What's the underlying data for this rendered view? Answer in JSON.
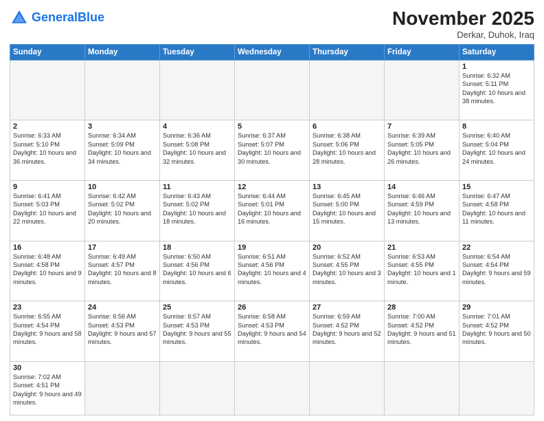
{
  "header": {
    "logo_general": "General",
    "logo_blue": "Blue",
    "month_title": "November 2025",
    "location": "Derkar, Duhok, Iraq"
  },
  "weekdays": [
    "Sunday",
    "Monday",
    "Tuesday",
    "Wednesday",
    "Thursday",
    "Friday",
    "Saturday"
  ],
  "weeks": [
    [
      {
        "day": "",
        "info": ""
      },
      {
        "day": "",
        "info": ""
      },
      {
        "day": "",
        "info": ""
      },
      {
        "day": "",
        "info": ""
      },
      {
        "day": "",
        "info": ""
      },
      {
        "day": "",
        "info": ""
      },
      {
        "day": "1",
        "info": "Sunrise: 6:32 AM\nSunset: 5:11 PM\nDaylight: 10 hours and 38 minutes."
      }
    ],
    [
      {
        "day": "2",
        "info": "Sunrise: 6:33 AM\nSunset: 5:10 PM\nDaylight: 10 hours and 36 minutes."
      },
      {
        "day": "3",
        "info": "Sunrise: 6:34 AM\nSunset: 5:09 PM\nDaylight: 10 hours and 34 minutes."
      },
      {
        "day": "4",
        "info": "Sunrise: 6:36 AM\nSunset: 5:08 PM\nDaylight: 10 hours and 32 minutes."
      },
      {
        "day": "5",
        "info": "Sunrise: 6:37 AM\nSunset: 5:07 PM\nDaylight: 10 hours and 30 minutes."
      },
      {
        "day": "6",
        "info": "Sunrise: 6:38 AM\nSunset: 5:06 PM\nDaylight: 10 hours and 28 minutes."
      },
      {
        "day": "7",
        "info": "Sunrise: 6:39 AM\nSunset: 5:05 PM\nDaylight: 10 hours and 26 minutes."
      },
      {
        "day": "8",
        "info": "Sunrise: 6:40 AM\nSunset: 5:04 PM\nDaylight: 10 hours and 24 minutes."
      }
    ],
    [
      {
        "day": "9",
        "info": "Sunrise: 6:41 AM\nSunset: 5:03 PM\nDaylight: 10 hours and 22 minutes."
      },
      {
        "day": "10",
        "info": "Sunrise: 6:42 AM\nSunset: 5:02 PM\nDaylight: 10 hours and 20 minutes."
      },
      {
        "day": "11",
        "info": "Sunrise: 6:43 AM\nSunset: 5:02 PM\nDaylight: 10 hours and 18 minutes."
      },
      {
        "day": "12",
        "info": "Sunrise: 6:44 AM\nSunset: 5:01 PM\nDaylight: 10 hours and 16 minutes."
      },
      {
        "day": "13",
        "info": "Sunrise: 6:45 AM\nSunset: 5:00 PM\nDaylight: 10 hours and 15 minutes."
      },
      {
        "day": "14",
        "info": "Sunrise: 6:46 AM\nSunset: 4:59 PM\nDaylight: 10 hours and 13 minutes."
      },
      {
        "day": "15",
        "info": "Sunrise: 6:47 AM\nSunset: 4:58 PM\nDaylight: 10 hours and 11 minutes."
      }
    ],
    [
      {
        "day": "16",
        "info": "Sunrise: 6:48 AM\nSunset: 4:58 PM\nDaylight: 10 hours and 9 minutes."
      },
      {
        "day": "17",
        "info": "Sunrise: 6:49 AM\nSunset: 4:57 PM\nDaylight: 10 hours and 8 minutes."
      },
      {
        "day": "18",
        "info": "Sunrise: 6:50 AM\nSunset: 4:56 PM\nDaylight: 10 hours and 6 minutes."
      },
      {
        "day": "19",
        "info": "Sunrise: 6:51 AM\nSunset: 4:56 PM\nDaylight: 10 hours and 4 minutes."
      },
      {
        "day": "20",
        "info": "Sunrise: 6:52 AM\nSunset: 4:55 PM\nDaylight: 10 hours and 3 minutes."
      },
      {
        "day": "21",
        "info": "Sunrise: 6:53 AM\nSunset: 4:55 PM\nDaylight: 10 hours and 1 minute."
      },
      {
        "day": "22",
        "info": "Sunrise: 6:54 AM\nSunset: 4:54 PM\nDaylight: 9 hours and 59 minutes."
      }
    ],
    [
      {
        "day": "23",
        "info": "Sunrise: 6:55 AM\nSunset: 4:54 PM\nDaylight: 9 hours and 58 minutes."
      },
      {
        "day": "24",
        "info": "Sunrise: 6:56 AM\nSunset: 4:53 PM\nDaylight: 9 hours and 57 minutes."
      },
      {
        "day": "25",
        "info": "Sunrise: 6:57 AM\nSunset: 4:53 PM\nDaylight: 9 hours and 55 minutes."
      },
      {
        "day": "26",
        "info": "Sunrise: 6:58 AM\nSunset: 4:53 PM\nDaylight: 9 hours and 54 minutes."
      },
      {
        "day": "27",
        "info": "Sunrise: 6:59 AM\nSunset: 4:52 PM\nDaylight: 9 hours and 52 minutes."
      },
      {
        "day": "28",
        "info": "Sunrise: 7:00 AM\nSunset: 4:52 PM\nDaylight: 9 hours and 51 minutes."
      },
      {
        "day": "29",
        "info": "Sunrise: 7:01 AM\nSunset: 4:52 PM\nDaylight: 9 hours and 50 minutes."
      }
    ],
    [
      {
        "day": "30",
        "info": "Sunrise: 7:02 AM\nSunset: 4:51 PM\nDaylight: 9 hours and 49 minutes."
      },
      {
        "day": "",
        "info": ""
      },
      {
        "day": "",
        "info": ""
      },
      {
        "day": "",
        "info": ""
      },
      {
        "day": "",
        "info": ""
      },
      {
        "day": "",
        "info": ""
      },
      {
        "day": "",
        "info": ""
      }
    ]
  ]
}
